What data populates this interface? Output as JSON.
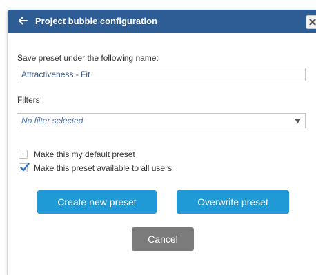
{
  "dialog": {
    "title": "Project bubble configuration"
  },
  "preset_name": {
    "label": "Save preset under the following name:",
    "value": "Attractiveness - Fit"
  },
  "filters": {
    "label": "Filters",
    "selected": "No filter selected"
  },
  "options": [
    {
      "label": "Make this my default preset",
      "checked": false
    },
    {
      "label": "Make this preset available to all users",
      "checked": true
    }
  ],
  "buttons": {
    "create": "Create new preset",
    "overwrite": "Overwrite preset",
    "cancel": "Cancel"
  },
  "colors": {
    "titlebar": "#2e5c94",
    "primary": "#1f9ad6",
    "secondary": "#7b7b7b",
    "check": "#2f74c0"
  }
}
